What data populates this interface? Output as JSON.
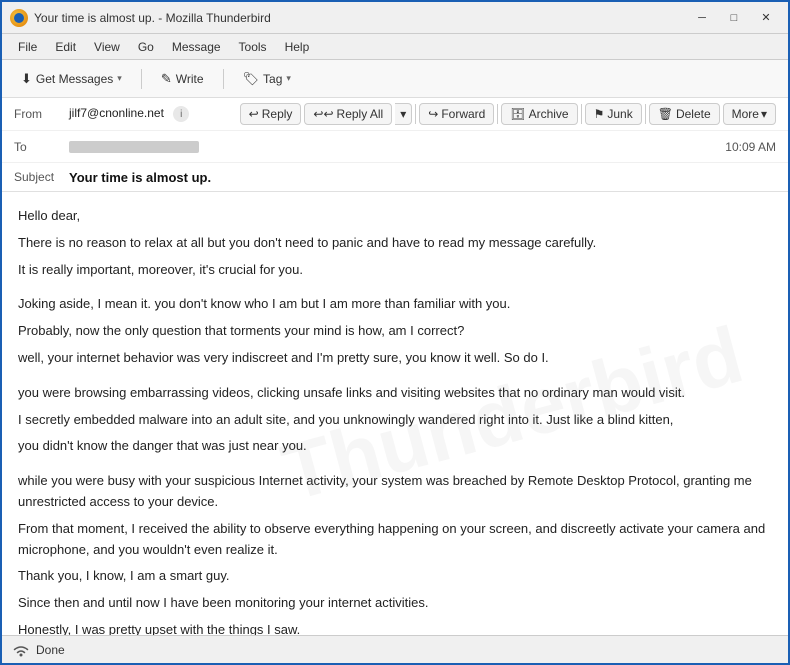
{
  "titleBar": {
    "title": "Your time is almost up. - Mozilla Thunderbird",
    "minimize": "─",
    "maximize": "□",
    "close": "✕"
  },
  "menuBar": {
    "items": [
      "File",
      "Edit",
      "View",
      "Go",
      "Message",
      "Tools",
      "Help"
    ]
  },
  "toolbar": {
    "getMessages": "Get Messages",
    "write": "Write",
    "tag": "Tag"
  },
  "emailHeader": {
    "fromLabel": "From",
    "fromValue": "jilf7@cnonline.net",
    "toLabel": "To",
    "subjectLabel": "Subject",
    "subjectValue": "Your time is almost up.",
    "time": "10:09 AM",
    "actions": {
      "reply": "Reply",
      "replyAll": "Reply All",
      "forward": "Forward",
      "archive": "Archive",
      "junk": "Junk",
      "delete": "Delete",
      "more": "More"
    }
  },
  "body": {
    "paragraphs": [
      "Hello dear,",
      "There is no reason to relax at all but you don't need to panic and have to read my message carefully.",
      "It is really important, moreover, it's crucial for you.",
      "",
      "Joking aside, I mean it. you don't know who I am but I am more than familiar with you.",
      "Probably, now the only question that torments your mind is how, am I correct?",
      "well, your internet behavior was very indiscreet and I'm pretty sure, you know it well. So do I.",
      "",
      "you were browsing embarrassing videos, clicking unsafe links and visiting websites that no ordinary man would visit.",
      "I secretly embedded malware into an adult site, and you unknowingly wandered right into it. Just like a blind kitten,",
      "you didn't know the danger that was just near you.",
      "",
      "while you were busy with your suspicious Internet activity, your system was breached by Remote Desktop Protocol, granting me unrestricted access to your device.",
      "From that moment, I received the ability to observe everything happening on your screen, and discreetly activate your camera and microphone, and you wouldn't even realize it.",
      "Thank you, I know, I am a smart guy.",
      "Since then and until now I have been monitoring your internet activities.",
      "Honestly, I was pretty upset with the things I saw."
    ]
  },
  "statusBar": {
    "status": "Done",
    "wifiIcon": "(()))"
  },
  "icons": {
    "reply": "↩",
    "replyAll": "↩↩",
    "forward": "↪",
    "archive": "🗄",
    "junk": "⚑",
    "delete": "🗑",
    "pencil": "✎",
    "tag": "🏷",
    "chevronDown": "▾",
    "info": "i"
  }
}
